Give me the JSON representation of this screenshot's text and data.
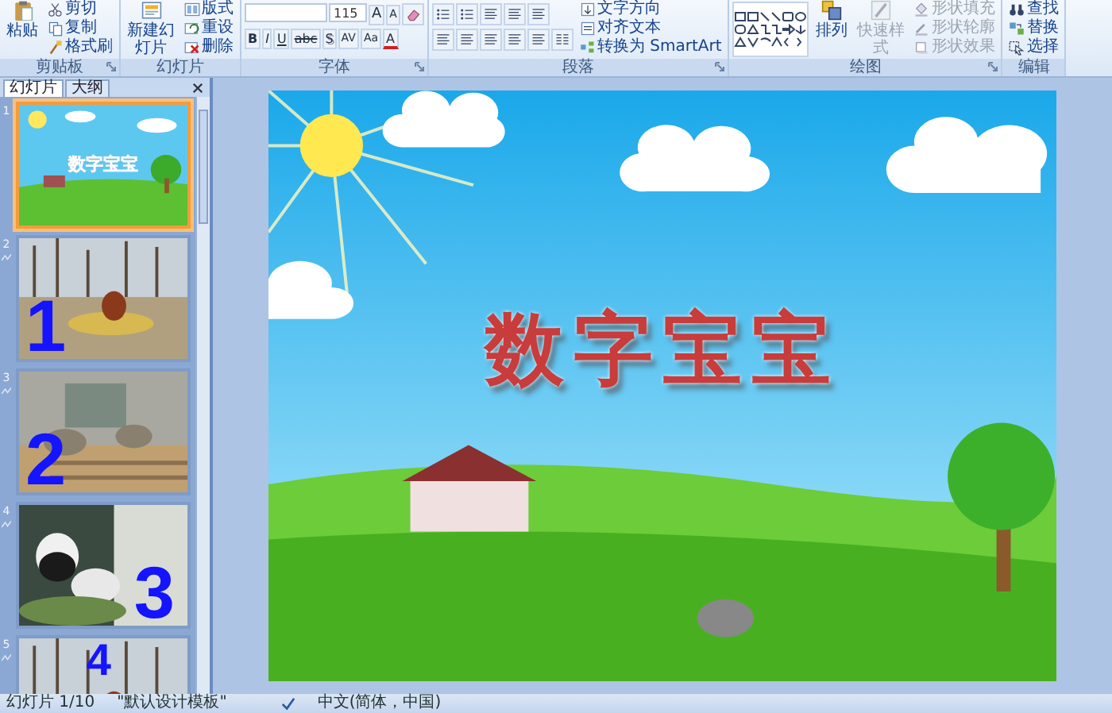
{
  "ribbon": {
    "groups": [
      {
        "label": "剪贴板",
        "launcher": true,
        "columns": [
          [
            [
              {
                "kind": "paste",
                "label": "粘贴"
              }
            ]
          ],
          [
            [
              {
                "kind": "scissors",
                "label": "剪切"
              }
            ],
            [
              {
                "kind": "copy",
                "label": "复制"
              }
            ],
            [
              {
                "kind": "brush",
                "label": "格式刷"
              }
            ]
          ]
        ]
      },
      {
        "label": "幻灯片",
        "launcher": false,
        "columns": [
          [
            [
              {
                "kind": "new-slide",
                "label": "新建幻灯片"
              }
            ]
          ],
          [
            [
              {
                "kind": "layout",
                "label": "版式"
              }
            ],
            [
              {
                "kind": "reset",
                "label": "重设"
              }
            ],
            [
              {
                "kind": "delete",
                "label": "删除"
              }
            ]
          ]
        ]
      },
      {
        "label": "字体",
        "launcher": true,
        "columns": [
          [
            [
              {
                "kind": "font-field"
              },
              {
                "kind": "size-field",
                "value": "115"
              },
              {
                "kind": "grow",
                "label": "A"
              },
              {
                "kind": "shrink",
                "label": "A"
              },
              {
                "kind": "eraser"
              }
            ],
            [
              {
                "kind": "bold",
                "label": "B"
              },
              {
                "kind": "italic",
                "label": "I"
              },
              {
                "kind": "underline",
                "label": "U"
              },
              {
                "kind": "strike",
                "label": "abc"
              },
              {
                "kind": "shadow",
                "label": "S"
              },
              {
                "kind": "spacing",
                "label": "AV"
              },
              {
                "kind": "case",
                "label": "Aa"
              },
              {
                "kind": "color",
                "label": "A"
              }
            ]
          ]
        ]
      },
      {
        "label": "段落",
        "launcher": true,
        "columns": [
          [
            [
              {
                "kind": "bullets"
              },
              {
                "kind": "bullets"
              },
              {
                "kind": "lines"
              },
              {
                "kind": "lines"
              },
              {
                "kind": "lines"
              }
            ],
            [
              {
                "kind": "lines"
              },
              {
                "kind": "lines"
              },
              {
                "kind": "lines"
              },
              {
                "kind": "lines"
              },
              {
                "kind": "lines"
              },
              {
                "kind": "columns"
              }
            ]
          ],
          [
            [
              {
                "kind": "text-direction",
                "label": "文字方向"
              }
            ],
            [
              {
                "kind": "align-text",
                "label": "对齐文本"
              }
            ],
            [
              {
                "kind": "smartart",
                "label": "转换为 SmartArt"
              }
            ]
          ]
        ]
      },
      {
        "label": "绘图",
        "launcher": true,
        "columns": [
          [
            [
              {
                "kind": "shapes"
              }
            ]
          ],
          [
            [
              {
                "kind": "arrange",
                "label": "排列"
              }
            ]
          ],
          [
            [
              {
                "kind": "quick-style",
                "label": "快速样式",
                "disabled": true
              }
            ]
          ],
          [
            [
              {
                "kind": "fill",
                "label": "形状填充",
                "disabled": true
              }
            ],
            [
              {
                "kind": "outline",
                "label": "形状轮廓",
                "disabled": true
              }
            ],
            [
              {
                "kind": "effect",
                "label": "形状效果",
                "disabled": true
              }
            ]
          ]
        ]
      },
      {
        "label": "编辑",
        "launcher": false,
        "columns": [
          [
            [
              {
                "kind": "find",
                "label": "查找"
              }
            ],
            [
              {
                "kind": "replace",
                "label": "替换"
              }
            ],
            [
              {
                "kind": "select",
                "label": "选择"
              }
            ]
          ]
        ]
      }
    ]
  },
  "pane": {
    "tabs": [
      {
        "label": "幻灯片",
        "selected": true
      },
      {
        "label": "大纲",
        "selected": false
      }
    ],
    "thumbnails": [
      {
        "number": "1",
        "selected": true,
        "animated": false,
        "kind": "title",
        "text": "数字宝宝"
      },
      {
        "number": "2",
        "selected": false,
        "animated": true,
        "text": "1"
      },
      {
        "number": "3",
        "selected": false,
        "animated": true,
        "text": "2"
      },
      {
        "number": "4",
        "selected": false,
        "animated": true,
        "text": "3"
      },
      {
        "number": "5",
        "selected": false,
        "animated": true,
        "text": "4"
      }
    ]
  },
  "slide": {
    "title": "数字宝宝"
  },
  "status_bar": {
    "slide": "幻灯片 1/10",
    "theme": "\"默认设计模板\"",
    "language": "中文(简体，中国)"
  }
}
